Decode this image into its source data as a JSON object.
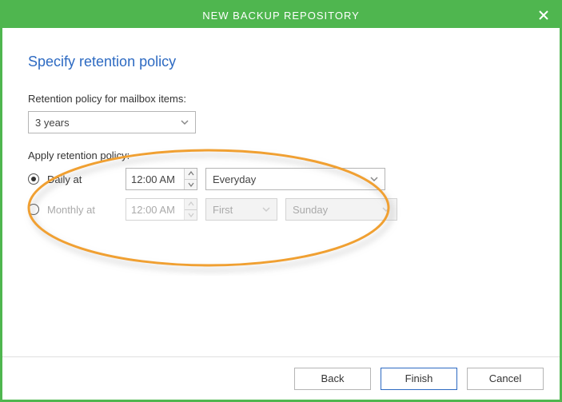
{
  "window": {
    "title": "NEW BACKUP REPOSITORY"
  },
  "heading": "Specify retention policy",
  "retention": {
    "label": "Retention policy for mailbox items:",
    "value": "3 years"
  },
  "apply": {
    "label": "Apply retention policy:",
    "daily": {
      "label": "Daily at",
      "time": "12:00 AM",
      "day": "Everyday",
      "selected": true
    },
    "monthly": {
      "label": "Monthly at",
      "time": "12:00 AM",
      "ordinal": "First",
      "day": "Sunday",
      "selected": false
    }
  },
  "footer": {
    "back": "Back",
    "finish": "Finish",
    "cancel": "Cancel"
  }
}
